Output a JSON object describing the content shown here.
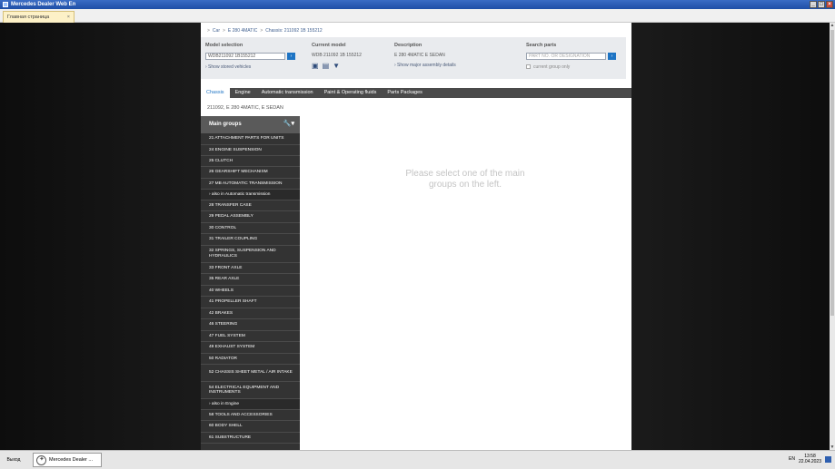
{
  "window": {
    "title": "Mercedes Dealer Web En",
    "buttons": [
      "_",
      "□",
      "×"
    ]
  },
  "tab": {
    "label": "Главная страница",
    "close": "×"
  },
  "breadcrumb": [
    ">",
    "Car",
    ">",
    "E 280 4MATIC",
    ">",
    "Chassis: 211092 1B 155212"
  ],
  "model_selection": {
    "heading": "Model selection",
    "input_value": "WDB211092 1B155212",
    "go": "›",
    "link": "› Show stored vehicles"
  },
  "current_model": {
    "heading": "Current model",
    "value": "WDB 211092 1B 155212"
  },
  "description": {
    "heading": "Description",
    "value": "E 280 4MATIC E SEDAN",
    "link": "› Show major assembly details"
  },
  "search_parts": {
    "heading": "Search parts",
    "placeholder": "PART NO. OR DESIGNATION",
    "go": "›",
    "checkbox_label": "current group only"
  },
  "subtabs": [
    "Chassis",
    "Engine",
    "Automatic transmission",
    "Paint & Operating fluids",
    "Parts Packages"
  ],
  "vehicle_line": "211092, E 280 4MATIC, E SEDAN",
  "groups": {
    "heading": "Main groups",
    "items": [
      "21 ATTACHMENT PARTS FOR UNITS",
      "24 ENGINE SUSPENSION",
      "25 CLUTCH",
      "26 GEARSHIFT MECHANISM",
      "27 MB AUTOMATIC TRANSMISSION",
      "› also in Automatic transmission",
      "28 TRANSFER CASE",
      "29 PEDAL ASSEMBLY",
      "30 CONTROL",
      "31 TRAILER COUPLING",
      "32 SPRINGS, SUSPENSION AND HYDRAULICS",
      "33 FRONT AXLE",
      "35 REAR AXLE",
      "40 WHEELS",
      "41 PROPELLER SHAFT",
      "42 BRAKES",
      "46 STEERING",
      "47 FUEL SYSTEM",
      "49 EXHAUST SYSTEM",
      "50 RADIATOR",
      "52 CHASSIS SHEET METAL / AIR INTAKE",
      "54 ELECTRICAL EQUIPMENT AND INSTRUMENTS",
      "› also in Engine",
      "58 TOOLS AND ACCESSORIES",
      "60 BODY SHELL",
      "61 SUBSTRUCTURE"
    ]
  },
  "message": "Please select one of the main groups on the left.",
  "taskbar": {
    "exit": "Выход",
    "task": "Mercedes Dealer ...",
    "lang": "EN",
    "time": "13:58",
    "date": "22.04.2023"
  }
}
